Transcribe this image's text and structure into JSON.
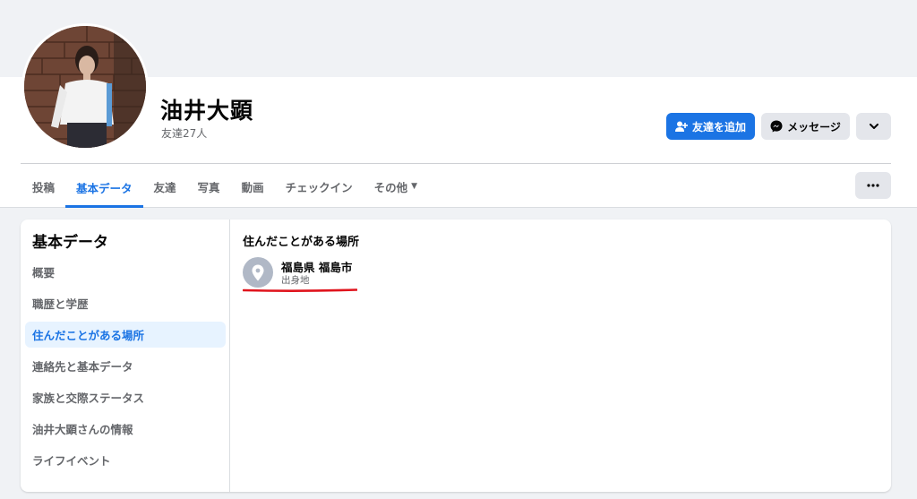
{
  "profile": {
    "name": "油井大顕",
    "friends": "友達27人"
  },
  "actions": {
    "add_friend": "友達を追加",
    "message": "メッセージ"
  },
  "tabs": [
    {
      "label": "投稿",
      "active": false
    },
    {
      "label": "基本データ",
      "active": true
    },
    {
      "label": "友達",
      "active": false
    },
    {
      "label": "写真",
      "active": false
    },
    {
      "label": "動画",
      "active": false
    },
    {
      "label": "チェックイン",
      "active": false
    },
    {
      "label": "その他",
      "active": false
    }
  ],
  "about": {
    "title": "基本データ",
    "items": [
      {
        "label": "概要",
        "active": false
      },
      {
        "label": "職歴と学歴",
        "active": false
      },
      {
        "label": "住んだことがある場所",
        "active": true
      },
      {
        "label": "連絡先と基本データ",
        "active": false
      },
      {
        "label": "家族と交際ステータス",
        "active": false
      },
      {
        "label": "油井大顕さんの情報",
        "active": false
      },
      {
        "label": "ライフイベント",
        "active": false
      }
    ]
  },
  "places": {
    "title": "住んだことがある場所",
    "entries": [
      {
        "name": "福島県 福島市",
        "type": "出身地",
        "icon": "map-pin-icon"
      }
    ]
  },
  "colors": {
    "accent": "#1b74e4",
    "annotation": "#e0141d"
  }
}
